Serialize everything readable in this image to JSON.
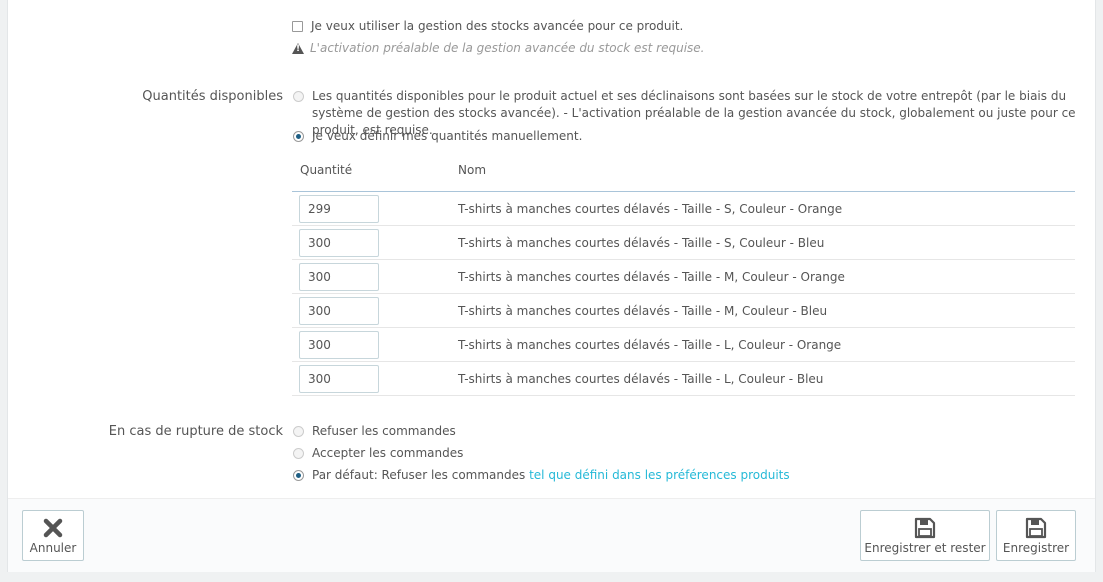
{
  "advanced_stock": {
    "checkbox_label": "Je veux utiliser la gestion des stocks avancée pour ce produit.",
    "warning": "L'activation préalable de la gestion avancée du stock est requise.",
    "checked": false
  },
  "available_quantities": {
    "label": "Quantités disponibles",
    "option_warehouse": "Les quantités disponibles pour le produit actuel et ses déclinaisons sont basées sur le stock de votre entrepôt (par le biais du système de gestion des stocks avancée).  - L'activation préalable de la gestion avancée du stock, globalement ou juste pour ce produit, est requise.",
    "option_manual": "Je veux définir mes quantités manuellement.",
    "selected": "manual"
  },
  "table": {
    "col_quantity": "Quantité",
    "col_name": "Nom",
    "rows": [
      {
        "qty": "299",
        "name": "T-shirts à manches courtes délavés - Taille - S, Couleur - Orange"
      },
      {
        "qty": "300",
        "name": "T-shirts à manches courtes délavés - Taille - S, Couleur - Bleu"
      },
      {
        "qty": "300",
        "name": "T-shirts à manches courtes délavés - Taille - M, Couleur - Orange"
      },
      {
        "qty": "300",
        "name": "T-shirts à manches courtes délavés - Taille - M, Couleur - Bleu"
      },
      {
        "qty": "300",
        "name": "T-shirts à manches courtes délavés - Taille - L, Couleur - Orange"
      },
      {
        "qty": "300",
        "name": "T-shirts à manches courtes délavés - Taille - L, Couleur - Bleu"
      }
    ]
  },
  "out_of_stock": {
    "label": "En cas de rupture de stock",
    "option_refuse": "Refuser les commandes",
    "option_accept": "Accepter les commandes",
    "option_default": "Par défaut: Refuser les commandes",
    "option_default_link": "tel que défini dans les préférences produits",
    "selected": "default"
  },
  "footer": {
    "cancel_label": "Annuler",
    "save_stay_label": "Enregistrer et rester",
    "save_label": "Enregistrer"
  },
  "colors": {
    "link": "#25b9d7",
    "radio_checked": "#1f5f84"
  }
}
